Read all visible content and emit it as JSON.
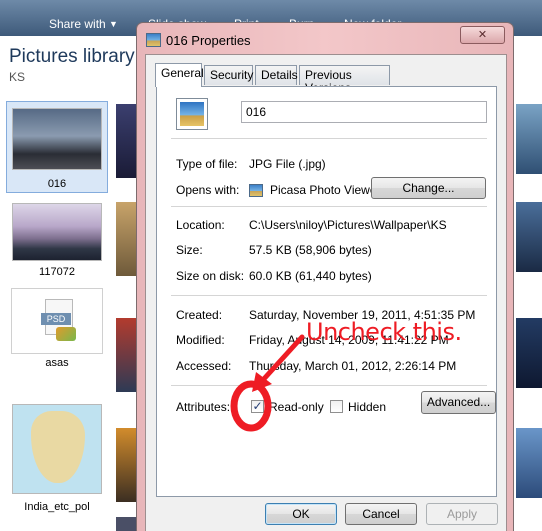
{
  "explorer": {
    "toolbar": {
      "share_with": "Share with",
      "slide_show": "Slide show",
      "print": "Print",
      "burn": "Burn",
      "new_folder": "New folder"
    },
    "library_title": "Pictures library",
    "library_subtitle": "KS",
    "items": [
      {
        "label": "016"
      },
      {
        "label": "117072"
      },
      {
        "label": "asas"
      },
      {
        "label": "India_etc_pol"
      }
    ],
    "psd_badge": "PSD"
  },
  "dialog": {
    "title": "016 Properties",
    "close_label": "✕",
    "tabs": [
      {
        "label": "General"
      },
      {
        "label": "Security"
      },
      {
        "label": "Details"
      },
      {
        "label": "Previous Versions"
      }
    ],
    "file_name": "016",
    "type_label": "Type of file:",
    "type_value": "JPG File (.jpg)",
    "opens_label": "Opens with:",
    "opens_value": "Picasa Photo Viewer",
    "change_label": "Change...",
    "location_label": "Location:",
    "location_value": "C:\\Users\\niloy\\Pictures\\Wallpaper\\KS",
    "size_label": "Size:",
    "size_value": "57.5 KB (58,906 bytes)",
    "size_on_disk_label": "Size on disk:",
    "size_on_disk_value": "60.0 KB (61,440 bytes)",
    "created_label": "Created:",
    "created_value": "Saturday, November 19, 2011, 4:51:35 PM",
    "modified_label": "Modified:",
    "modified_value": "Friday, August 14, 2009, 11:41:22 PM",
    "accessed_label": "Accessed:",
    "accessed_value": "Thursday, March 01, 2012, 2:26:14 PM",
    "attributes_label": "Attributes:",
    "readonly_label": "Read-only",
    "readonly_checked": true,
    "hidden_label": "Hidden",
    "hidden_checked": false,
    "advanced_label": "Advanced...",
    "ok_label": "OK",
    "cancel_label": "Cancel",
    "apply_label": "Apply",
    "check_mark": "✓"
  },
  "annotation": {
    "text": "Uncheck this.",
    "color": "#ee1c24"
  }
}
